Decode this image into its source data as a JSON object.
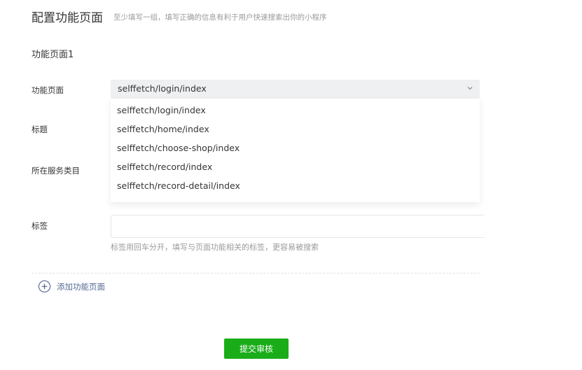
{
  "header": {
    "title": "配置功能页面",
    "subtitle": "至少填写一组，填写正确的信息有利于用户快速搜索出你的小程序"
  },
  "section": {
    "title": "功能页面1"
  },
  "form": {
    "page_label": "功能页面",
    "page_value": "selffetch/login/index",
    "page_options": [
      "selffetch/login/index",
      "selffetch/home/index",
      "selffetch/choose-shop/index",
      "selffetch/record/index",
      "selffetch/record-detail/index"
    ],
    "title_label": "标题",
    "category_label": "所在服务类目",
    "tag_label": "标签",
    "tag_value": "",
    "tag_hint": "标签用回车分开，填写与页面功能相关的标签，更容易被搜索"
  },
  "actions": {
    "add_page": "添加功能页面",
    "submit": "提交审核"
  },
  "colors": {
    "accent": "#1aad19",
    "link": "#576b95"
  }
}
